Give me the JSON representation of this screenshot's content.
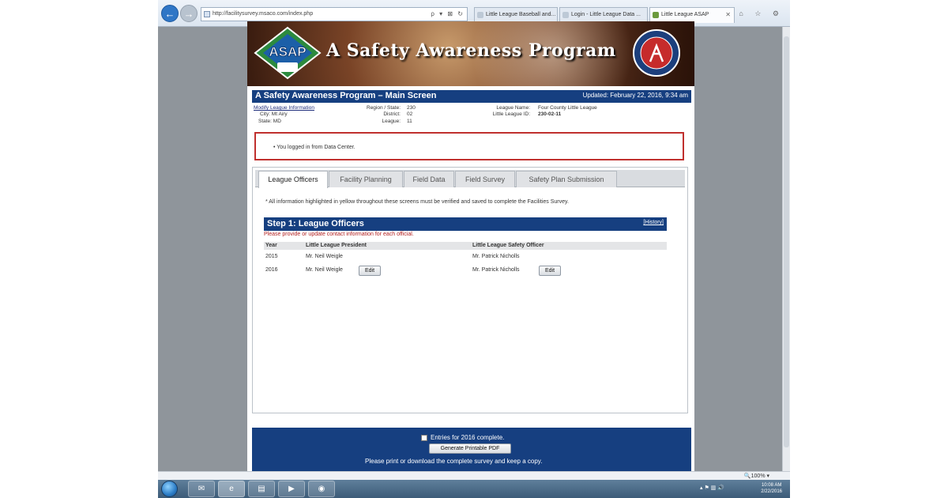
{
  "browser": {
    "address_url": "http://facilitysurvey.msaco.com/index.php",
    "address_tools": "ρ ▾ ⊠ ↻",
    "tabs": [
      {
        "label": "Little League Baseball and..."
      },
      {
        "label": "Login - Little League Data ..."
      },
      {
        "label": "Little League ASAP"
      }
    ],
    "tab_close": "✕",
    "window_icons": "⌂ ☆ ⚙"
  },
  "banner": {
    "logo_text": "ASAP",
    "title": "A Safety Awareness Program"
  },
  "main_header": {
    "title": "A Safety Awareness Program – Main Screen",
    "updated": "Updated: February 22, 2016, 9:34 am"
  },
  "league_info": {
    "modify_link": "Modify League Information",
    "city": "City:  Mt Airy",
    "state": "State:  MD",
    "region_label": "Region / State:",
    "region_value": "230",
    "district_label": "District:",
    "district_value": "02",
    "league_label": "League:",
    "league_value": "11",
    "league_name_label": "League Name:",
    "league_name_value": "Four County Little League",
    "league_id_label": "Little League ID:",
    "league_id_value": "230-02-11"
  },
  "message": {
    "text": "•   You logged in from Data Center."
  },
  "tabs": [
    {
      "label": "League Officers"
    },
    {
      "label": "Facility Planning"
    },
    {
      "label": "Field Data"
    },
    {
      "label": "Field Survey"
    },
    {
      "label": "Safety Plan Submission"
    }
  ],
  "required_note": "* All information highlighted in yellow throughout these screens must be verified and saved to complete the Facilities Survey.",
  "step": {
    "title": "Step 1: League Officers",
    "history_link": "[History]",
    "instruction": "Please provide or update contact information for each official."
  },
  "officers_table": {
    "headers": [
      "Year",
      "Little League President",
      "Little League Safety Officer"
    ],
    "rows": [
      {
        "year": "2015",
        "president": "Mr. Neil Weigle",
        "safety_officer": "Mr. Patrick Nicholls"
      },
      {
        "year": "2016",
        "president": "Mr. Neil Weigle",
        "safety_officer": "Mr. Patrick Nicholls"
      }
    ],
    "edit_label": "Edit"
  },
  "footer": {
    "checkbox_label": "Entries for 2016 complete.",
    "pdf_button": "Generate Printable PDF",
    "print_note": "Please print or download the complete survey and keep a copy."
  },
  "statusbar": {
    "zoom": "🔍100%  ▾"
  },
  "taskbar": {
    "items": [
      {
        "name": "outlook",
        "glyph": "✉"
      },
      {
        "name": "internet-explorer",
        "glyph": "e"
      },
      {
        "name": "file-explorer",
        "glyph": "▤"
      },
      {
        "name": "media-player",
        "glyph": "▶"
      },
      {
        "name": "app",
        "glyph": "◉"
      }
    ],
    "tray": "▴  ⚑  ▥  🔊",
    "time": "10:08 AM",
    "date": "2/22/2016"
  },
  "colors": {
    "header_navy": "#163f80",
    "message_border": "#c0302e",
    "instruction_red": "#b32020"
  }
}
